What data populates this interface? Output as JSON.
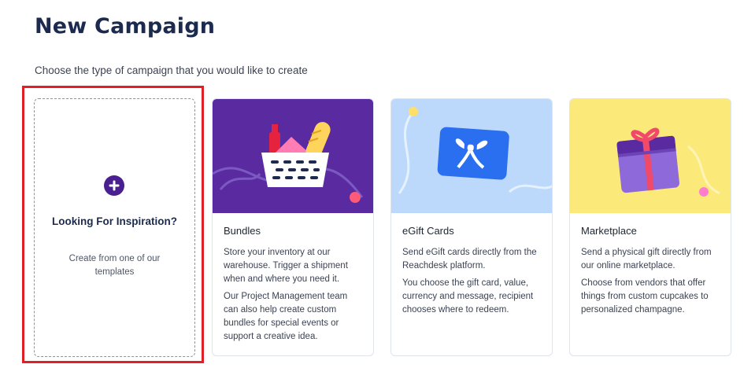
{
  "page": {
    "title": "New Campaign",
    "subtitle": "Choose the type of campaign that you would like to create"
  },
  "inspiration": {
    "icon": "plus-circle-icon",
    "title": "Looking For Inspiration?",
    "description": "Create from one of our templates"
  },
  "cards": [
    {
      "id": "bundles",
      "name": "Bundles",
      "illustration": "gift-basket-illustration",
      "paragraphs": [
        "Store your inventory at our warehouse. Trigger a shipment when and where you need it.",
        "Our Project Management team can also help create custom bundles for special events or support a creative idea."
      ]
    },
    {
      "id": "egift-cards",
      "name": "eGift Cards",
      "illustration": "gift-card-illustration",
      "paragraphs": [
        "Send eGift cards directly from the Reachdesk platform.",
        "You choose the gift card, value, currency and message, recipient chooses where to redeem."
      ]
    },
    {
      "id": "marketplace",
      "name": "Marketplace",
      "illustration": "gift-box-illustration",
      "paragraphs": [
        "Send a physical gift directly from our online marketplace.",
        "Choose from vendors that offer things from custom cupcakes to personalized champagne."
      ]
    }
  ],
  "colors": {
    "title": "#1b2a4e",
    "accent_purple": "#4a1f8f",
    "highlight_border": "#e01f26",
    "bundles_bg": "#5a2aa0",
    "egift_bg": "#bcd9fb",
    "marketplace_bg": "#fbe97a"
  }
}
